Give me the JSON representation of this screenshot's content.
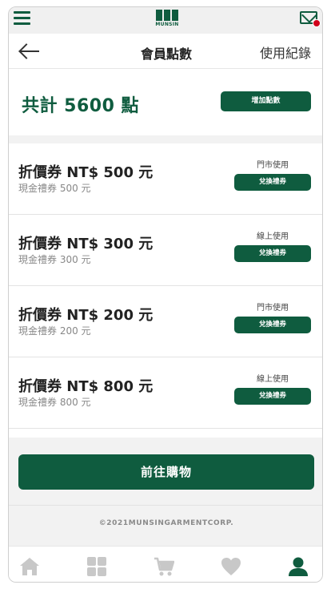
{
  "brand": {
    "logo_text": "MUNSIN"
  },
  "header": {
    "title": "會員點數",
    "history_link": "使用紀錄"
  },
  "points": {
    "total_label": "共計 5600 點",
    "add_button": "增加點數"
  },
  "coupons": [
    {
      "name": "折價券 NT$ 500 元",
      "desc": "現金禮券 500 元",
      "usage": "門市使用",
      "button": "兌換禮券"
    },
    {
      "name": "折價券 NT$ 300 元",
      "desc": "現金禮券 300 元",
      "usage": "線上使用",
      "button": "兌換禮券"
    },
    {
      "name": "折價券 NT$ 200 元",
      "desc": "現金禮券 200 元",
      "usage": "門市使用",
      "button": "兌換禮券"
    },
    {
      "name": "折價券 NT$ 800 元",
      "desc": "現金禮券 800 元",
      "usage": "線上使用",
      "button": "兌換禮券"
    }
  ],
  "shop_button": "前往購物",
  "footer": {
    "copyright": "©2021MUNSINGARMENTCORP."
  },
  "tabs": [
    {
      "icon": "home-icon",
      "active": false
    },
    {
      "icon": "grid-icon",
      "active": false
    },
    {
      "icon": "cart-icon",
      "active": false
    },
    {
      "icon": "heart-icon",
      "active": false
    },
    {
      "icon": "user-icon",
      "active": true
    }
  ],
  "colors": {
    "brand_green": "#0f5c3f",
    "notify_red": "#d0021b",
    "tab_inactive": "#c8c8c8"
  }
}
